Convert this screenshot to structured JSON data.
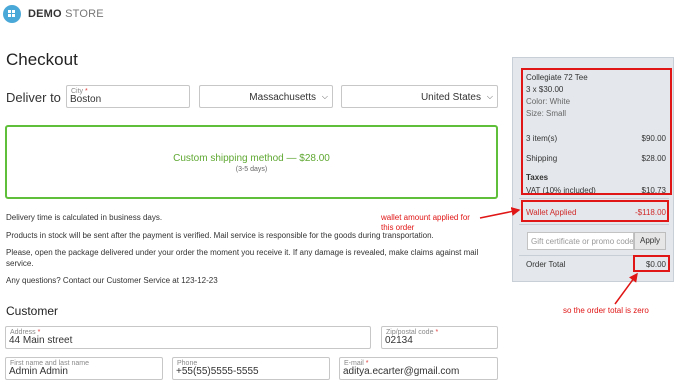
{
  "header": {
    "brand_bold": "DEMO",
    "brand_light": "STORE"
  },
  "page": {
    "title": "Checkout"
  },
  "delivery": {
    "label": "Deliver to",
    "city_label": "City",
    "city_value": "Boston",
    "state_value": "Massachusetts",
    "country_value": "United States"
  },
  "shipping": {
    "method": "Custom shipping method — $28.00",
    "days": "(3-5 days)"
  },
  "info": {
    "line1": "Delivery time is calculated in business days.",
    "line2": "Products in stock will be sent after the payment is verified. Mail service is responsible for the goods during transportation.",
    "line3": "Please, open the package delivered under your order the moment you receive it. If any damage is revealed, make claims against mail service.",
    "line4": "Any questions? Contact our Customer Service at 123-12-23"
  },
  "customer": {
    "title": "Customer",
    "address_label": "Address",
    "address_value": "44 Main street",
    "zip_label": "Zip/postal code",
    "zip_value": "02134",
    "name_label": "First name and last name",
    "name_value": "Admin Admin",
    "phone_label": "Phone",
    "phone_value": "+55(55)5555-5555",
    "email_label": "E-mail",
    "email_value": "aditya.ecarter@gmail.com"
  },
  "summary": {
    "product_name": "Collegiate 72 Tee",
    "product_qty": "3 x $30.00",
    "product_color": "Color: White",
    "product_size": "Size: Small",
    "items_label": "3 item(s)",
    "items_value": "$90.00",
    "shipping_label": "Shipping",
    "shipping_value": "$28.00",
    "taxes_title": "Taxes",
    "vat_label": "VAT (10% included)",
    "vat_value": "$10.73",
    "wallet_label": "Wallet Applied",
    "wallet_value": "-$118.00",
    "gift_placeholder": "Gift certificate or promo code",
    "apply_label": "Apply",
    "total_label": "Order Total",
    "total_value": "$0.00"
  },
  "annotations": {
    "wallet_note_1": "wallet amount applied for",
    "wallet_note_2": "this order",
    "total_note": "so the order total is zero"
  },
  "colors": {
    "accent_green": "#5fbf3a",
    "annotation_red": "#e01515",
    "summary_bg": "#e4e8ec"
  }
}
